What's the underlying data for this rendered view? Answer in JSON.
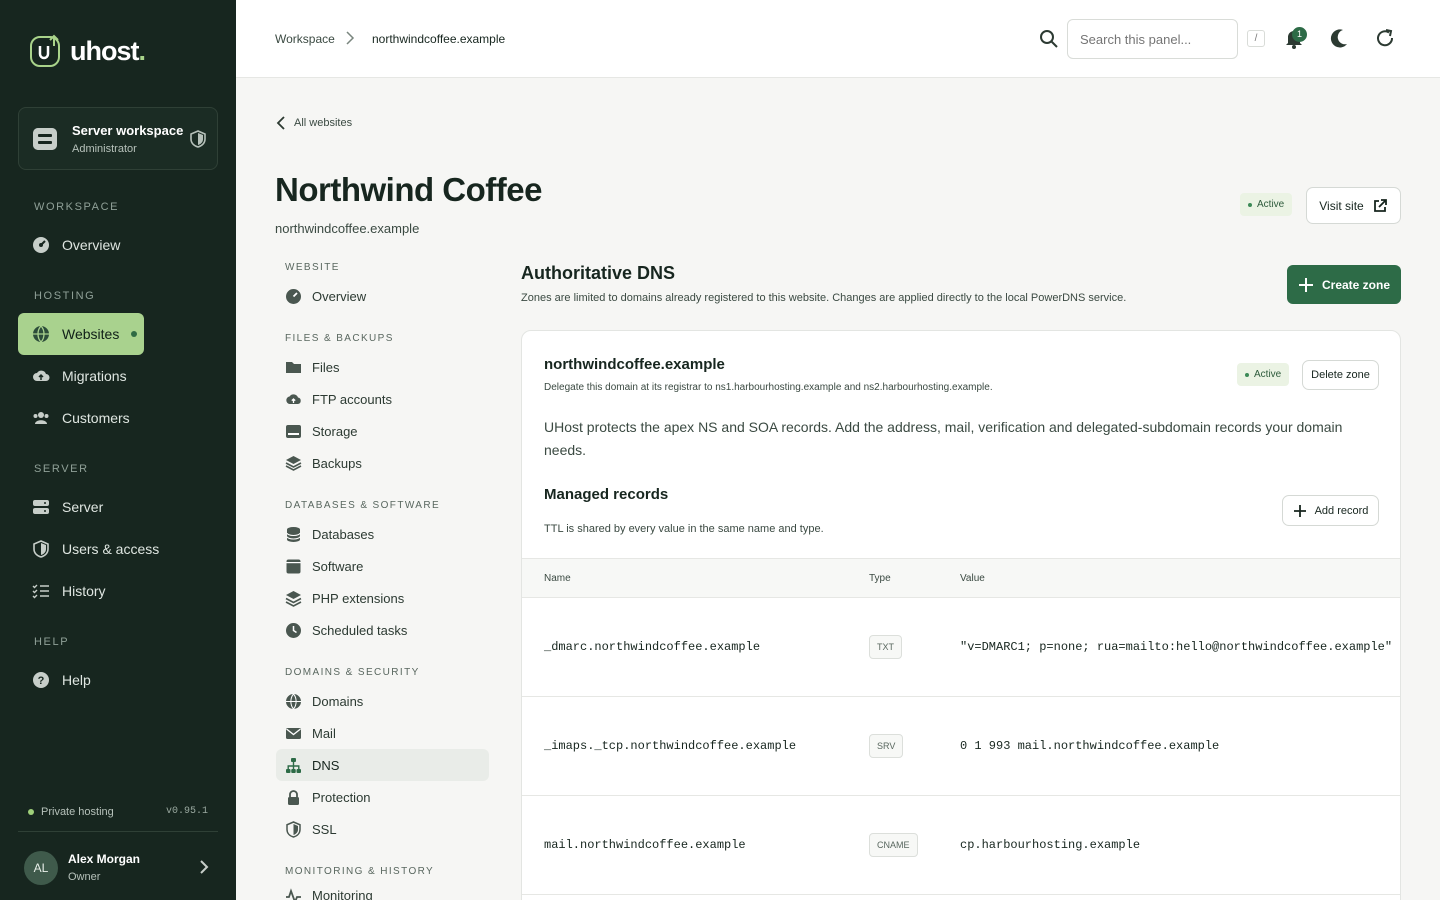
{
  "brand": {
    "name": "uhost",
    "dot": "."
  },
  "workspace": {
    "title": "Server workspace",
    "role": "Administrator"
  },
  "sidebar": {
    "sections": [
      {
        "label": "WORKSPACE"
      },
      {
        "label": "HOSTING"
      },
      {
        "label": "SERVER"
      },
      {
        "label": "HELP"
      }
    ],
    "items": [
      {
        "label": "Overview",
        "icon": "gauge-icon"
      },
      {
        "label": "Websites",
        "icon": "globe-icon",
        "active": true
      },
      {
        "label": "Migrations",
        "icon": "cloud-upload-icon"
      },
      {
        "label": "Customers",
        "icon": "users-icon"
      },
      {
        "label": "Server",
        "icon": "server-icon"
      },
      {
        "label": "Users & access",
        "icon": "shield-icon"
      },
      {
        "label": "History",
        "icon": "list-check-icon"
      },
      {
        "label": "Help",
        "icon": "question-icon"
      }
    ],
    "footer": {
      "status": "Private hosting",
      "version": "v0.95.1"
    },
    "user": {
      "initials": "AL",
      "name": "Alex Morgan",
      "role": "Owner"
    }
  },
  "topbar": {
    "breadcrumb": [
      "Workspace",
      "northwindcoffee.example"
    ],
    "search_placeholder": "Search this panel...",
    "shortcut": "/",
    "notifications": "1"
  },
  "header": {
    "back_label": "All websites",
    "title": "Northwind Coffee",
    "domain": "northwindcoffee.example",
    "status": "Active",
    "visit_label": "Visit site"
  },
  "subnav": {
    "sections": [
      "WEBSITE",
      "FILES & BACKUPS",
      "DATABASES & SOFTWARE",
      "DOMAINS & SECURITY",
      "MONITORING & HISTORY"
    ],
    "items": [
      {
        "label": "Overview"
      },
      {
        "label": "Files"
      },
      {
        "label": "FTP accounts"
      },
      {
        "label": "Storage"
      },
      {
        "label": "Backups"
      },
      {
        "label": "Databases"
      },
      {
        "label": "Software"
      },
      {
        "label": "PHP extensions"
      },
      {
        "label": "Scheduled tasks"
      },
      {
        "label": "Domains"
      },
      {
        "label": "Mail"
      },
      {
        "label": "DNS",
        "active": true
      },
      {
        "label": "Protection"
      },
      {
        "label": "SSL"
      },
      {
        "label": "Monitoring"
      }
    ]
  },
  "dns": {
    "title": "Authoritative DNS",
    "description": "Zones are limited to domains already registered to this website. Changes are applied directly to the local PowerDNS service.",
    "create_label": "Create zone",
    "zone": {
      "name": "northwindcoffee.example",
      "delegation": "Delegate this domain at its registrar to ns1.harbourhosting.example and ns2.harbourhosting.example.",
      "status": "Active",
      "delete_label": "Delete zone",
      "note": "UHost protects the apex NS and SOA records. Add the address, mail, verification and delegated-subdomain records your domain needs."
    },
    "records": {
      "title": "Managed records",
      "description": "TTL is shared by every value in the same name and type.",
      "add_label": "Add record",
      "columns": [
        "Name",
        "Type",
        "Value"
      ],
      "rows": [
        {
          "name": "_dmarc.northwindcoffee.example",
          "type": "TXT",
          "value": "\"v=DMARC1; p=none; rua=mailto:hello@northwindcoffee.example\""
        },
        {
          "name": "_imaps._tcp.northwindcoffee.example",
          "type": "SRV",
          "value": "0 1 993 mail.northwindcoffee.example"
        },
        {
          "name": "mail.northwindcoffee.example",
          "type": "CNAME",
          "value": "cp.harbourhosting.example"
        }
      ]
    }
  }
}
